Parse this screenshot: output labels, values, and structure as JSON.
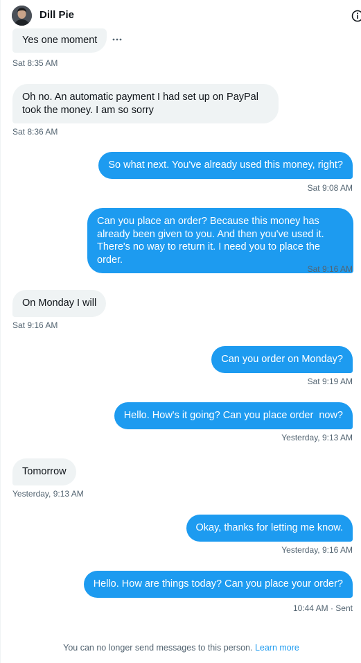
{
  "header": {
    "name": "Dill Pie",
    "avatar": "user-avatar",
    "info_icon": "info-icon"
  },
  "messages": [
    {
      "dir": "in",
      "text": "Yes one moment",
      "time": "Sat 8:35 AM"
    },
    {
      "dir": "in",
      "text": "Oh no. An automatic payment I had set up on PayPal took the money. I am so sorry",
      "time": "Sat 8:36 AM"
    },
    {
      "dir": "out",
      "text": "So what next. You've already used this money, right?",
      "time": "Sat 9:08 AM"
    },
    {
      "dir": "out",
      "text": "Can you place an order? Because this money has already been given to you. And then you've used it. There's no way to return it. I need you to place the order.",
      "time": "Sat 9:16 AM"
    },
    {
      "dir": "in",
      "text": "On Monday I will",
      "time": "Sat 9:16 AM"
    },
    {
      "dir": "out",
      "text": "Can you order on Monday?",
      "time": "Sat 9:19 AM"
    },
    {
      "dir": "out",
      "text": "Hello. How's it going? Can you place order  now?",
      "time": "Yesterday, 9:13 AM"
    },
    {
      "dir": "in",
      "text": "Tomorrow",
      "time": "Yesterday, 9:13 AM"
    },
    {
      "dir": "out",
      "text": "Okay, thanks for letting me know.",
      "time": "Yesterday, 9:16 AM"
    },
    {
      "dir": "out",
      "text": "Hello. How are things today? Can you place your order?",
      "time": "10:44 AM · Sent"
    }
  ],
  "footer": {
    "text": "You can no longer send messages to this person.",
    "link": "Learn more"
  },
  "colors": {
    "outgoing": "#1d9bf0",
    "incoming": "#eff3f4",
    "muted": "#536471"
  }
}
